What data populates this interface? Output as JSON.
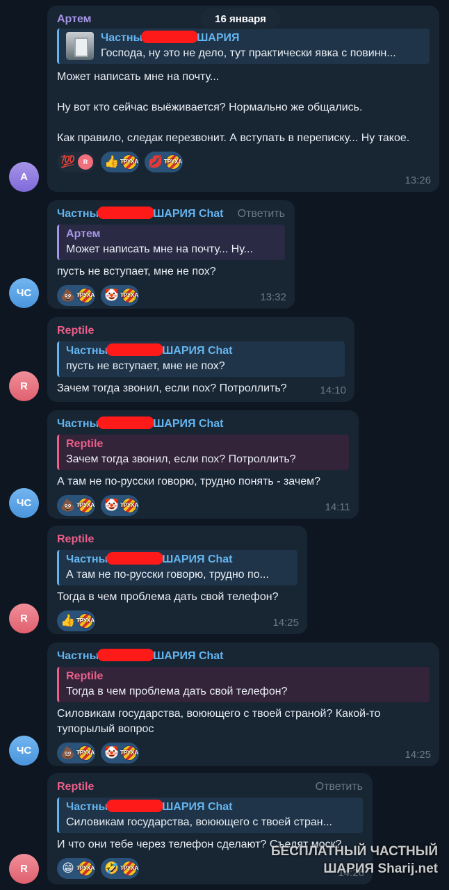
{
  "date_label": "16 января",
  "watermark": {
    "line1": "БЕСПЛАТНЫЙ  ЧАСТНЫЙ",
    "line2": "ШАРИЯ",
    "line3": "Sharij.net"
  },
  "messages": [
    {
      "avatar": "А",
      "sender": "Артем",
      "quote": {
        "name_prefix": "Частны",
        "name_suffix": "ШАРИЯ",
        "text": "Господа, ну это не дело, тут практически явка с повинн..."
      },
      "text": "Может написать мне на почту...\n\nНу вот кто сейчас выёживается? Нормально же общались.\n\nКак правило, следак перезвонит. А вступать в переписку... Ну такое.",
      "reactions": [
        {
          "emoji": "💯",
          "badge": "R"
        },
        {
          "emoji": "👍",
          "badge": "ТРУХА"
        },
        {
          "emoji": "💋",
          "badge": "ТРУХА"
        }
      ],
      "time": "13:26"
    },
    {
      "avatar": "ЧС",
      "sender_prefix": "Частны",
      "sender_suffix": "ШАРИЯ Chat",
      "reply_label": "Ответить",
      "quote": {
        "name": "Артем",
        "text": "Может написать мне на почту...  Ну..."
      },
      "text": "пусть не вступает, мне не пох?",
      "reactions": [
        {
          "emoji": "💩",
          "badge": "ТРУХА"
        },
        {
          "emoji": "🤡",
          "badge": "ТРУХА"
        }
      ],
      "time": "13:32"
    },
    {
      "avatar": "R",
      "sender": "Reptile",
      "quote": {
        "name_prefix": "Частны",
        "name_suffix": "ШАРИЯ Chat",
        "text": "пусть не вступает, мне не пох?"
      },
      "text": "Зачем тогда звонил, если пох? Потроллить?",
      "time": "14:10"
    },
    {
      "avatar": "ЧС",
      "sender_prefix": "Частны",
      "sender_suffix": "ШАРИЯ Chat",
      "quote": {
        "name": "Reptile",
        "text": "Зачем тогда звонил, если пох? Потроллить?"
      },
      "text": "А там не по-русски говорю, трудно понять - зачем?",
      "reactions": [
        {
          "emoji": "💩",
          "badge": "ТРУХА"
        },
        {
          "emoji": "🤡",
          "badge": "ТРУХА"
        }
      ],
      "time": "14:11"
    },
    {
      "avatar": "R",
      "sender": "Reptile",
      "quote": {
        "name_prefix": "Частны",
        "name_suffix": "ШАРИЯ Chat",
        "text": "А там не по-русски говорю, трудно по..."
      },
      "text": "Тогда в чем проблема дать свой телефон?",
      "reactions": [
        {
          "emoji": "👍",
          "badge": "ТРУХА"
        }
      ],
      "time": "14:25"
    },
    {
      "avatar": "ЧС",
      "sender_prefix": "Частны",
      "sender_suffix": "ШАРИЯ Chat",
      "quote": {
        "name": "Reptile",
        "text": "Тогда в чем проблема дать свой телефон?"
      },
      "text": "Силовикам государства, воюющего с твоей страной? Какой-то тупорылый вопрос",
      "reactions": [
        {
          "emoji": "💩",
          "badge": "ТРУХА"
        },
        {
          "emoji": "🤡",
          "badge": "ТРУХА"
        }
      ],
      "time": "14:25"
    },
    {
      "avatar": "R",
      "sender": "Reptile",
      "reply_label": "Ответить",
      "quote": {
        "name_prefix": "Частны",
        "name_suffix": "ШАРИЯ Chat",
        "text": "Силовикам государства, воюющего с твоей стран..."
      },
      "text": "И что они тебе через телефон сделают? Съедят моск?",
      "reactions": [
        {
          "emoji": "😁",
          "badge": "ТРУХА"
        },
        {
          "emoji": "🤣",
          "badge": "ТРУХА"
        }
      ],
      "time": "14:26"
    }
  ]
}
